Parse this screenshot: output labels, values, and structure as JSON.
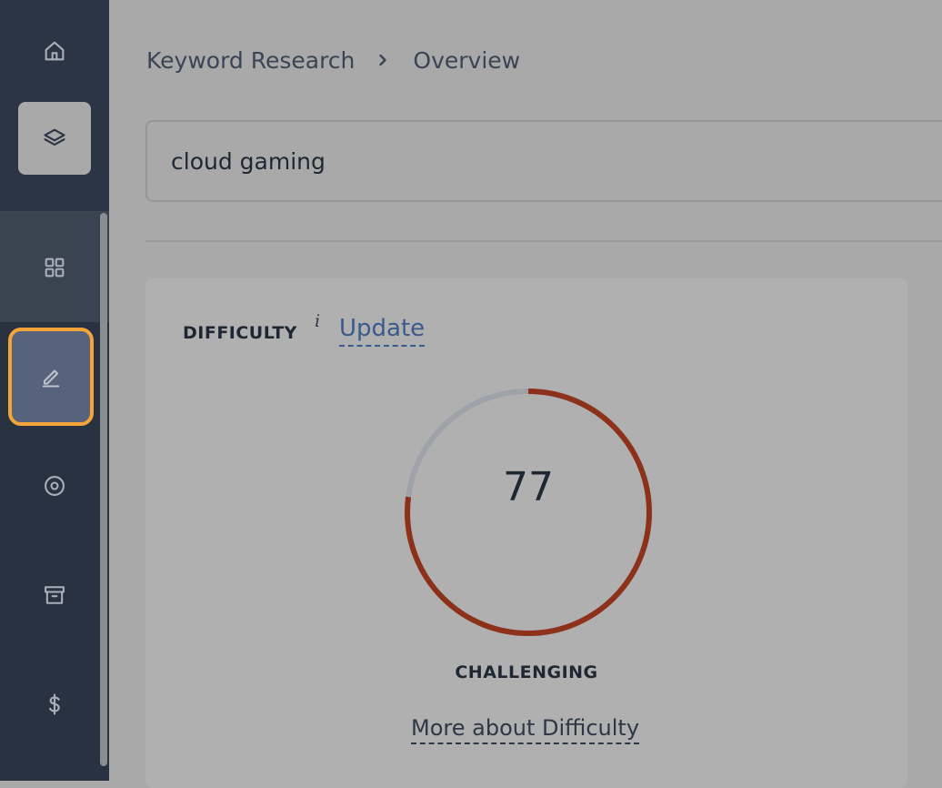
{
  "breadcrumb": {
    "items": [
      "Keyword Research",
      "Overview"
    ]
  },
  "search": {
    "value": "cloud gaming"
  },
  "difficulty": {
    "label": "DIFFICULTY",
    "info": "i",
    "update_link": "Update",
    "score": 77,
    "score_text": "77",
    "max": 100,
    "level": "CHALLENGING",
    "more_link": "More about Difficulty"
  },
  "sidebar": {
    "items": [
      {
        "icon": "home-icon"
      },
      {
        "icon": "layers-icon"
      },
      {
        "icon": "grid-icon"
      },
      {
        "icon": "pencil-icon"
      },
      {
        "icon": "target-icon"
      },
      {
        "icon": "archive-icon"
      },
      {
        "icon": "dollar-icon"
      }
    ]
  },
  "colors": {
    "sidebar": "#283241",
    "highlight": "#f4a438",
    "gauge_fill": "#8e311a",
    "gauge_track": "#9fa2a8",
    "link": "#3b5a8c"
  }
}
